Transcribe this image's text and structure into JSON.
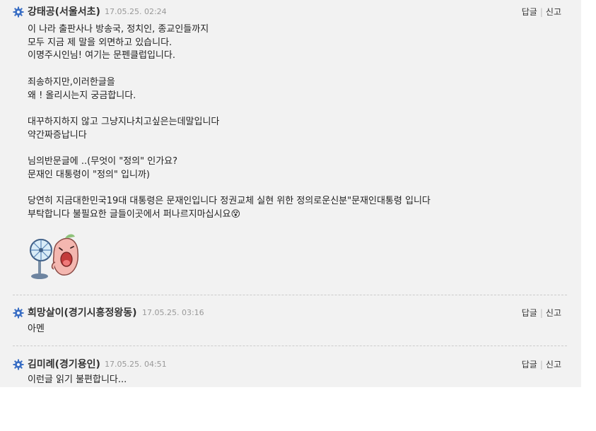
{
  "comments": [
    {
      "author": "강태공(서울서초)",
      "timestamp": "17.05.25. 02:24",
      "reply_label": "답글",
      "report_label": "신고",
      "body": "이 나라 출판사나 방송국, 정치인, 종교인들까지\n모두 지금 제 말을 외면하고 있습니다.\n이명주시인님! 여기는 문펜클럽입니다.\n\n죄송하지만,이러한글을\n왜 ! 올리시는지 궁금합니다.\n\n대꾸하지하지 않고 그냥지나치고싶은는데말입니다\n약간짜증납니다\n\n님의반문글에 ..(무엇이 \"정의\" 인가요?\n문재인 대통령이 \"정의\" 입니까)\n\n당연히 지금대한민국19대 대통령은 문재인입니다 정권교체 실현 위한 정의로운신분\"문재인대통령 입니다\n부탁합니다 불필요한 글들이곳에서 퍼나르지마십시요😵",
      "sticker_icon": "fan-character-sticker"
    },
    {
      "author": "희망살이(경기시흥정왕동)",
      "timestamp": "17.05.25. 03:16",
      "reply_label": "답글",
      "report_label": "신고",
      "body": "아멘"
    },
    {
      "author": "김미례(경기용인)",
      "timestamp": "17.05.25. 04:51",
      "reply_label": "답글",
      "report_label": "신고",
      "body": "이런글 읽기 불편합니다..."
    }
  ],
  "icons": {
    "author_badge": "gear-icon"
  },
  "colors": {
    "background": "#f2f2f2",
    "badge": "#3b6fc4",
    "timestamp": "#999999"
  }
}
